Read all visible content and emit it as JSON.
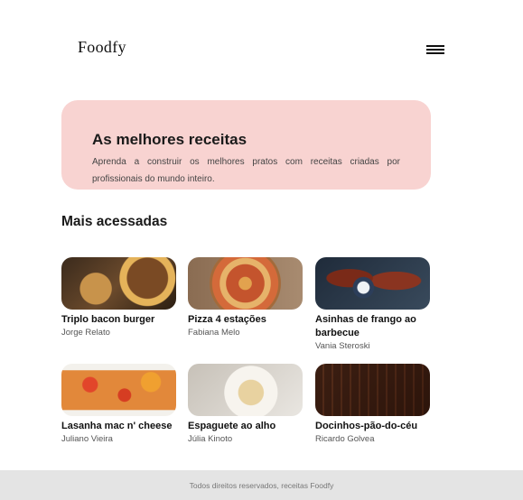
{
  "header": {
    "logo": "Foodfy",
    "menu_icon": "hamburger-menu-icon"
  },
  "hero": {
    "title": "As melhores receitas",
    "text": "Aprenda a construir os melhores pratos com receitas criadas por profissionais do mundo inteiro."
  },
  "section": {
    "title": "Mais acessadas"
  },
  "recipes": [
    {
      "title": "Triplo bacon burger",
      "author": "Jorge Relato"
    },
    {
      "title": "Pizza 4 estações",
      "author": "Fabiana Melo"
    },
    {
      "title": "Asinhas de frango ao barbecue",
      "author": "Vania Steroski"
    },
    {
      "title": "Lasanha mac n' cheese",
      "author": "Juliano Vieira"
    },
    {
      "title": "Espaguete ao alho",
      "author": "Júlia Kinoto"
    },
    {
      "title": "Docinhos-pão-do-céu",
      "author": "Ricardo Golvea"
    }
  ],
  "footer": {
    "text": "Todos direitos reservados, receitas Foodfy"
  },
  "colors": {
    "hero_bg": "#f8d3d1",
    "footer_bg": "#e4e4e4"
  }
}
